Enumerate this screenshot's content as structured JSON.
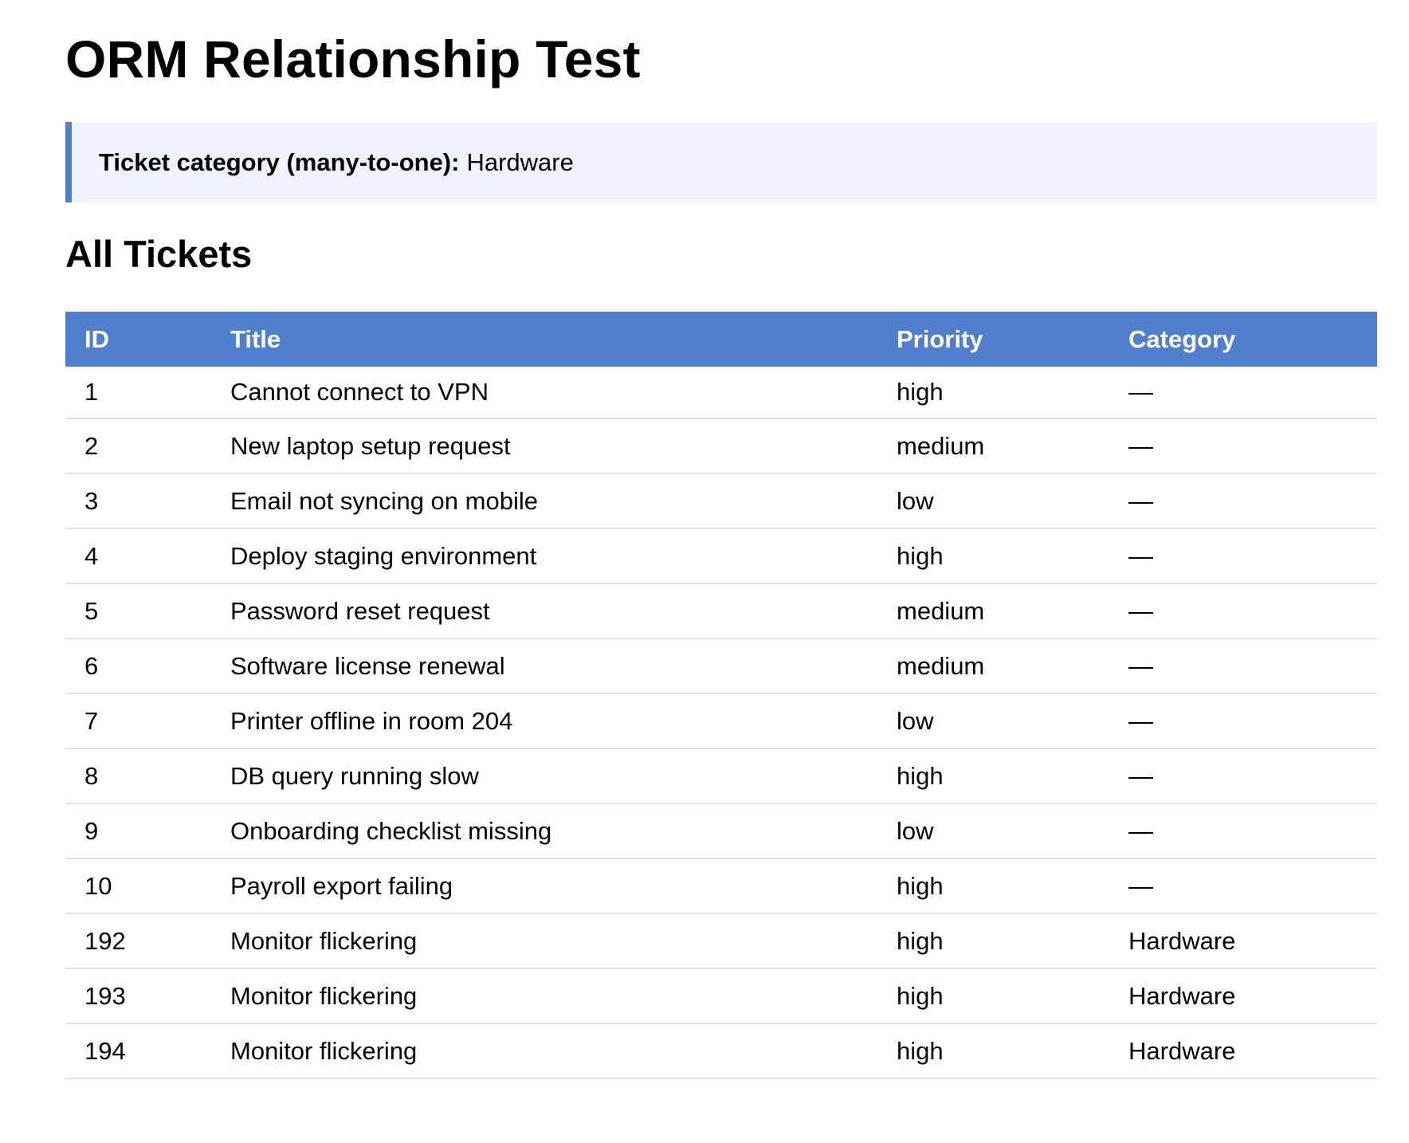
{
  "page": {
    "title": "ORM Relationship Test"
  },
  "info": {
    "label": "Ticket category (many-to-one):",
    "value": "Hardware"
  },
  "section": {
    "title": "All Tickets"
  },
  "table": {
    "headers": {
      "id": "ID",
      "title": "Title",
      "priority": "Priority",
      "category": "Category"
    },
    "rows": [
      {
        "id": "1",
        "title": "Cannot connect to VPN",
        "priority": "high",
        "category": "—"
      },
      {
        "id": "2",
        "title": "New laptop setup request",
        "priority": "medium",
        "category": "—"
      },
      {
        "id": "3",
        "title": "Email not syncing on mobile",
        "priority": "low",
        "category": "—"
      },
      {
        "id": "4",
        "title": "Deploy staging environment",
        "priority": "high",
        "category": "—"
      },
      {
        "id": "5",
        "title": "Password reset request",
        "priority": "medium",
        "category": "—"
      },
      {
        "id": "6",
        "title": "Software license renewal",
        "priority": "medium",
        "category": "—"
      },
      {
        "id": "7",
        "title": "Printer offline in room 204",
        "priority": "low",
        "category": "—"
      },
      {
        "id": "8",
        "title": "DB query running slow",
        "priority": "high",
        "category": "—"
      },
      {
        "id": "9",
        "title": "Onboarding checklist missing",
        "priority": "low",
        "category": "—"
      },
      {
        "id": "10",
        "title": "Payroll export failing",
        "priority": "high",
        "category": "—"
      },
      {
        "id": "192",
        "title": "Monitor flickering",
        "priority": "high",
        "category": "Hardware"
      },
      {
        "id": "193",
        "title": "Monitor flickering",
        "priority": "high",
        "category": "Hardware"
      },
      {
        "id": "194",
        "title": "Monitor flickering",
        "priority": "high",
        "category": "Hardware"
      }
    ]
  },
  "colors": {
    "accent": "#4f7fcd",
    "info_background": "#eef3fd",
    "row_divider": "#e2e2e2"
  }
}
